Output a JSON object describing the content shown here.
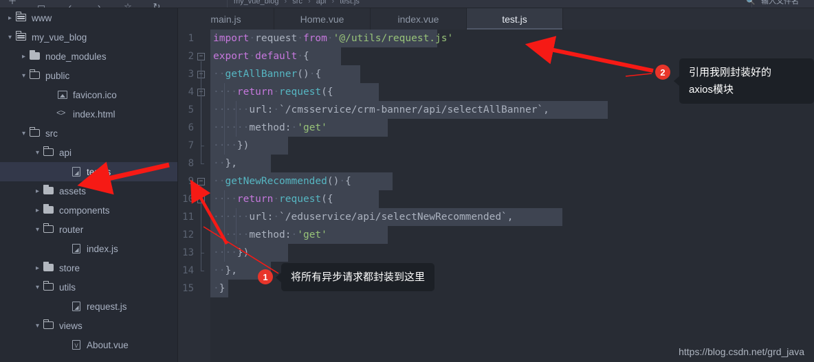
{
  "toolbar": {
    "icons": [
      "add-file-icon",
      "window-icon",
      "back-icon",
      "forward-icon",
      "bookmark-icon",
      "refresh-icon"
    ],
    "breadcrumb": [
      "my_vue_blog",
      "src",
      "api",
      "test.js"
    ],
    "right_label": "输入文件名",
    "right_icon": "search-file-icon"
  },
  "tree": {
    "items": [
      {
        "label": "www",
        "arrow": "›",
        "icon": "module-icon",
        "indent": 8,
        "selected": false
      },
      {
        "label": "my_vue_blog",
        "arrow": "⌄",
        "icon": "module-icon",
        "indent": 8,
        "selected": false
      },
      {
        "label": "node_modules",
        "arrow": "›",
        "icon": "folder-closed-icon",
        "indent": 28,
        "selected": false
      },
      {
        "label": "public",
        "arrow": "⌄",
        "icon": "folder-open-icon",
        "indent": 28,
        "selected": false
      },
      {
        "label": "favicon.ico",
        "arrow": "",
        "icon": "image-file-icon",
        "indent": 68,
        "selected": false
      },
      {
        "label": "index.html",
        "arrow": "",
        "icon": "html-file-icon",
        "indent": 68,
        "selected": false
      },
      {
        "label": "src",
        "arrow": "⌄",
        "icon": "folder-open-icon",
        "indent": 28,
        "selected": false
      },
      {
        "label": "api",
        "arrow": "⌄",
        "icon": "folder-open-icon",
        "indent": 48,
        "selected": false
      },
      {
        "label": "test.js",
        "arrow": "",
        "icon": "js-file-icon",
        "indent": 88,
        "selected": true
      },
      {
        "label": "assets",
        "arrow": "›",
        "icon": "folder-closed-icon",
        "indent": 48,
        "selected": false
      },
      {
        "label": "components",
        "arrow": "›",
        "icon": "folder-closed-icon",
        "indent": 48,
        "selected": false
      },
      {
        "label": "router",
        "arrow": "⌄",
        "icon": "folder-open-icon",
        "indent": 48,
        "selected": false
      },
      {
        "label": "index.js",
        "arrow": "",
        "icon": "js-file-icon",
        "indent": 88,
        "selected": false
      },
      {
        "label": "store",
        "arrow": "›",
        "icon": "folder-closed-icon",
        "indent": 48,
        "selected": false
      },
      {
        "label": "utils",
        "arrow": "⌄",
        "icon": "folder-open-icon",
        "indent": 48,
        "selected": false
      },
      {
        "label": "request.js",
        "arrow": "",
        "icon": "js-file-icon",
        "indent": 88,
        "selected": false
      },
      {
        "label": "views",
        "arrow": "⌄",
        "icon": "folder-open-icon",
        "indent": 48,
        "selected": false
      },
      {
        "label": "About.vue",
        "arrow": "",
        "icon": "vue-file-icon",
        "indent": 88,
        "selected": false
      }
    ]
  },
  "editor": {
    "tabs": [
      {
        "label": "main.js",
        "active": false
      },
      {
        "label": "Home.vue",
        "active": false
      },
      {
        "label": "index.vue",
        "active": false
      },
      {
        "label": "test.js",
        "active": true
      }
    ],
    "lines": [
      {
        "no": "1",
        "fold": false,
        "sel_w": 330,
        "indent": 0,
        "tokens": [
          {
            "t": "import",
            "c": "kw"
          },
          {
            "t": "·",
            "c": "dot"
          },
          {
            "t": "request",
            "c": "plain"
          },
          {
            "t": "·",
            "c": "dot"
          },
          {
            "t": "from",
            "c": "kw"
          },
          {
            "t": "·",
            "c": "dot"
          },
          {
            "t": "'@/utils/request.js'",
            "c": "str"
          }
        ]
      },
      {
        "no": "2",
        "fold": true,
        "sel_w": 190,
        "indent": 0,
        "tokens": [
          {
            "t": "export",
            "c": "kw"
          },
          {
            "t": "·",
            "c": "dot"
          },
          {
            "t": "default",
            "c": "kw"
          },
          {
            "t": "·",
            "c": "dot"
          },
          {
            "t": "{",
            "c": "punc"
          }
        ]
      },
      {
        "no": "3",
        "fold": true,
        "sel_w": 218,
        "indent": 0,
        "tokens": [
          {
            "t": "··",
            "c": "dot"
          },
          {
            "t": "getAllBanner",
            "c": "fn"
          },
          {
            "t": "()",
            "c": "punc"
          },
          {
            "t": "·",
            "c": "dot"
          },
          {
            "t": "{",
            "c": "punc"
          }
        ]
      },
      {
        "no": "4",
        "fold": true,
        "sel_w": 245,
        "indent": 1,
        "tokens": [
          {
            "t": "····",
            "c": "dot"
          },
          {
            "t": "return",
            "c": "kw"
          },
          {
            "t": "·",
            "c": "dot"
          },
          {
            "t": "request",
            "c": "fn"
          },
          {
            "t": "({",
            "c": "punc"
          }
        ]
      },
      {
        "no": "5",
        "fold": false,
        "sel_w": 578,
        "indent": 2,
        "tokens": [
          {
            "t": "······",
            "c": "dot"
          },
          {
            "t": "url:",
            "c": "plain"
          },
          {
            "t": "·",
            "c": "dot"
          },
          {
            "t": "`/cmsservice/crm-banner/api/selectAllBanner`,",
            "c": "plain"
          }
        ]
      },
      {
        "no": "6",
        "fold": false,
        "sel_w": 258,
        "indent": 2,
        "tokens": [
          {
            "t": "······",
            "c": "dot"
          },
          {
            "t": "method:",
            "c": "plain"
          },
          {
            "t": "·",
            "c": "dot"
          },
          {
            "t": "'get'",
            "c": "str"
          }
        ]
      },
      {
        "no": "7",
        "fold": false,
        "sel_w": 113,
        "indent": 1,
        "tokens": [
          {
            "t": "····",
            "c": "dot"
          },
          {
            "t": "})",
            "c": "punc"
          }
        ]
      },
      {
        "no": "8",
        "fold": false,
        "sel_w": 88,
        "indent": 0,
        "tokens": [
          {
            "t": "··",
            "c": "dot"
          },
          {
            "t": "},",
            "c": "punc"
          }
        ]
      },
      {
        "no": "9",
        "fold": true,
        "sel_w": 265,
        "indent": 0,
        "tokens": [
          {
            "t": "··",
            "c": "dot"
          },
          {
            "t": "getNewRecommended",
            "c": "fn"
          },
          {
            "t": "()",
            "c": "punc"
          },
          {
            "t": "·",
            "c": "dot"
          },
          {
            "t": "{",
            "c": "punc"
          }
        ]
      },
      {
        "no": "10",
        "fold": true,
        "sel_w": 245,
        "indent": 1,
        "tokens": [
          {
            "t": "····",
            "c": "dot"
          },
          {
            "t": "return",
            "c": "kw"
          },
          {
            "t": "·",
            "c": "dot"
          },
          {
            "t": "request",
            "c": "fn"
          },
          {
            "t": "({",
            "c": "punc"
          }
        ]
      },
      {
        "no": "11",
        "fold": false,
        "sel_w": 512,
        "indent": 2,
        "tokens": [
          {
            "t": "······",
            "c": "dot"
          },
          {
            "t": "url:",
            "c": "plain"
          },
          {
            "t": "·",
            "c": "dot"
          },
          {
            "t": "`/eduservice/api/selectNewRecommended`,",
            "c": "plain"
          }
        ]
      },
      {
        "no": "12",
        "fold": false,
        "sel_w": 258,
        "indent": 2,
        "tokens": [
          {
            "t": "······",
            "c": "dot"
          },
          {
            "t": "method:",
            "c": "plain"
          },
          {
            "t": "·",
            "c": "dot"
          },
          {
            "t": "'get'",
            "c": "str"
          }
        ]
      },
      {
        "no": "13",
        "fold": false,
        "sel_w": 113,
        "indent": 1,
        "tokens": [
          {
            "t": "····",
            "c": "dot"
          },
          {
            "t": "})",
            "c": "punc"
          }
        ]
      },
      {
        "no": "14",
        "fold": false,
        "sel_w": 88,
        "indent": 0,
        "tokens": [
          {
            "t": "··",
            "c": "dot"
          },
          {
            "t": "},",
            "c": "punc"
          }
        ]
      },
      {
        "no": "15",
        "fold": false,
        "sel_w": 26,
        "indent": 0,
        "tokens": [
          {
            "t": "·",
            "c": "dot"
          },
          {
            "t": "}",
            "c": "punc"
          }
        ]
      }
    ]
  },
  "annotations": [
    {
      "badge": "1",
      "text": "将所有异步请求都封装到这里"
    },
    {
      "badge": "2",
      "text": "引用我刚封装好的\naxios模块"
    }
  ],
  "watermark": "https://blog.csdn.net/grd_java",
  "colors": {
    "accent_red": "#e8352a",
    "keyword": "#c678dd",
    "function": "#56b6c2",
    "string": "#98c379",
    "editor_bg": "#282c34",
    "selection": "#3e4451"
  }
}
